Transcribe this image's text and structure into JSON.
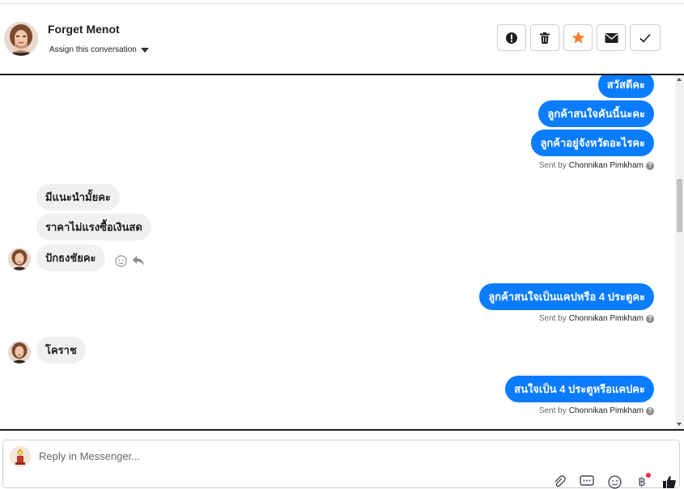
{
  "contact": {
    "name": "Forget Menot",
    "assign_label": "Assign this conversation"
  },
  "header_actions": [
    {
      "name": "mark-spam",
      "icon": "alert-icon"
    },
    {
      "name": "delete",
      "icon": "trash-icon"
    },
    {
      "name": "star",
      "icon": "star-icon",
      "color": "#f5822a"
    },
    {
      "name": "mark-unread",
      "icon": "envelope-icon"
    },
    {
      "name": "mark-done",
      "icon": "check-icon"
    }
  ],
  "messages": [
    {
      "direction": "out",
      "text": "สวัสดีคะ"
    },
    {
      "direction": "out",
      "text": "ลูกค้าสนใจคันนี้นะคะ"
    },
    {
      "direction": "out",
      "text": "ลูกค้าอยู่จังหวัดอะไรคะ"
    },
    {
      "direction": "in",
      "text": "มีแนะนำมั้ยคะ"
    },
    {
      "direction": "in",
      "text": "ราคาไม่แรงซื้อเงินสด"
    },
    {
      "direction": "in",
      "text": "ปักธงชัยคะ"
    },
    {
      "direction": "out",
      "text": "ลูกค้าสนใจเป็นแคปหรือ 4 ประตูคะ"
    },
    {
      "direction": "in",
      "text": "โคราช"
    },
    {
      "direction": "out",
      "text": "สนใจเป็น 4 ประตูหรือแคปคะ"
    }
  ],
  "sent_by": {
    "prefix": "Sent by",
    "agent": "Chonnikan Pimkham"
  },
  "composer": {
    "placeholder": "Reply in Messenger..."
  },
  "colors": {
    "outgoing_bubble": "#0a7cff",
    "incoming_bubble": "#f0f0f0",
    "star": "#f5822a"
  }
}
